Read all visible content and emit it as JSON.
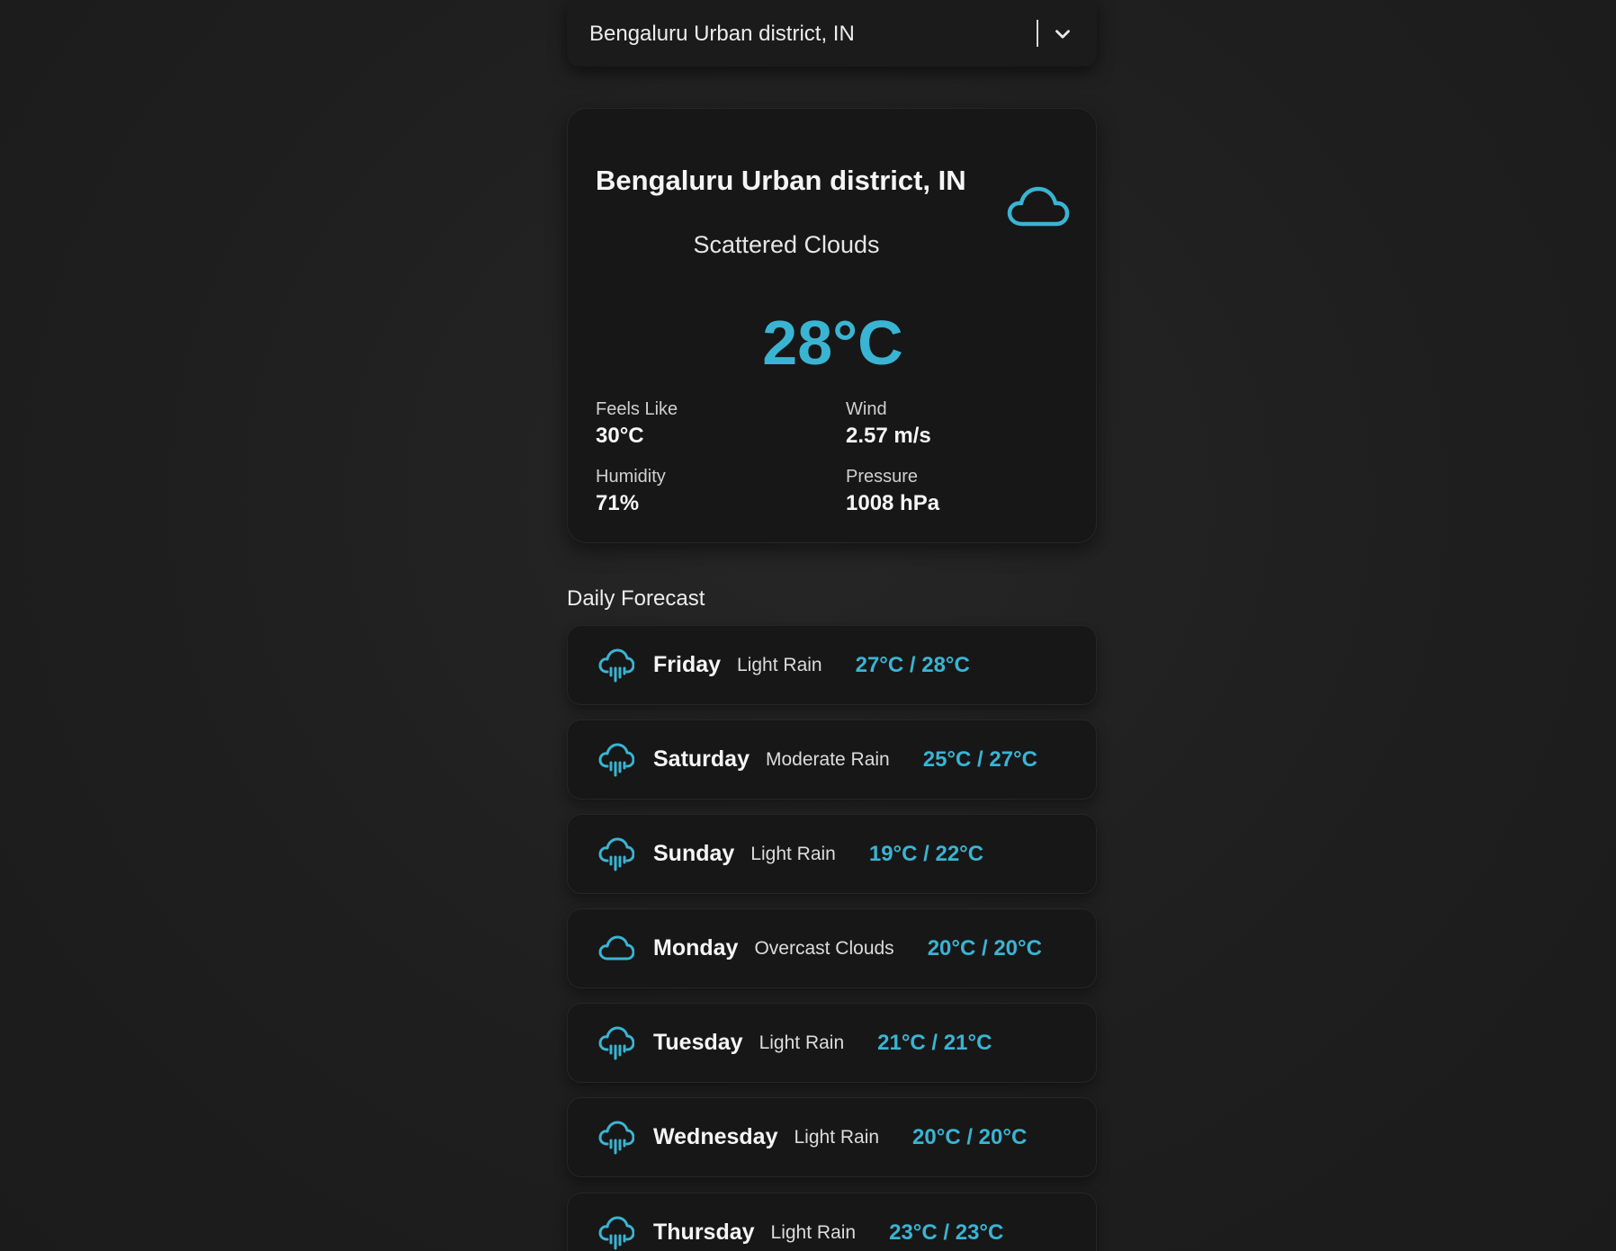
{
  "search": {
    "value": "Bengaluru Urban district, IN",
    "icon": "chevron-down-icon"
  },
  "current": {
    "city": "Bengaluru Urban district, IN",
    "description": "Scattered Clouds",
    "temperature": "28°C",
    "icon": "cloud-icon",
    "stats": {
      "feels_like": {
        "label": "Feels Like",
        "value": "30°C"
      },
      "wind": {
        "label": "Wind",
        "value": "2.57 m/s"
      },
      "humidity": {
        "label": "Humidity",
        "value": "71%"
      },
      "pressure": {
        "label": "Pressure",
        "value": "1008 hPa"
      }
    }
  },
  "forecast": {
    "title": "Daily Forecast",
    "days": [
      {
        "day": "Friday",
        "condition": "Light Rain",
        "range": "27°C / 28°C",
        "icon": "rain-cloud-icon"
      },
      {
        "day": "Saturday",
        "condition": "Moderate Rain",
        "range": "25°C / 27°C",
        "icon": "rain-cloud-icon"
      },
      {
        "day": "Sunday",
        "condition": "Light Rain",
        "range": "19°C / 22°C",
        "icon": "rain-cloud-icon"
      },
      {
        "day": "Monday",
        "condition": "Overcast Clouds",
        "range": "20°C / 20°C",
        "icon": "cloud-icon"
      },
      {
        "day": "Tuesday",
        "condition": "Light Rain",
        "range": "21°C / 21°C",
        "icon": "rain-cloud-icon"
      },
      {
        "day": "Wednesday",
        "condition": "Light Rain",
        "range": "20°C / 20°C",
        "icon": "rain-cloud-icon"
      },
      {
        "day": "Thursday",
        "condition": "Light Rain",
        "range": "23°C / 23°C",
        "icon": "rain-cloud-icon"
      }
    ]
  },
  "colors": {
    "accent": "#3ab4d3",
    "background": "#1f1f1f",
    "card": "#171717"
  }
}
